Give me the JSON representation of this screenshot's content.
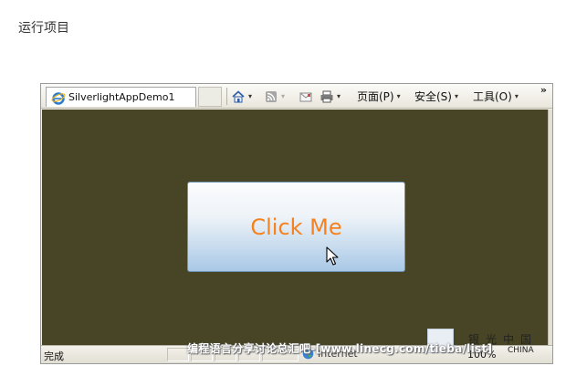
{
  "caption": "运行项目",
  "browser": {
    "tab_title": "SilverlightAppDemo1",
    "toolbar": {
      "page_label": "页面(P)",
      "safety_label": "安全(S)",
      "tools_label": "工具(O)",
      "more_label": "»"
    },
    "status": {
      "text": "完成",
      "zone": "Internet",
      "zoom": "100%"
    }
  },
  "app": {
    "button_label": "Click Me",
    "background_color": "#474525",
    "label_color": "#f5821f"
  },
  "overlay": {
    "watermark": "编程语言分享讨论总汇吧-[www.linecg.com/tieba/list]",
    "logo_chars": "银光中国",
    "logo_sub": "CHINA"
  }
}
